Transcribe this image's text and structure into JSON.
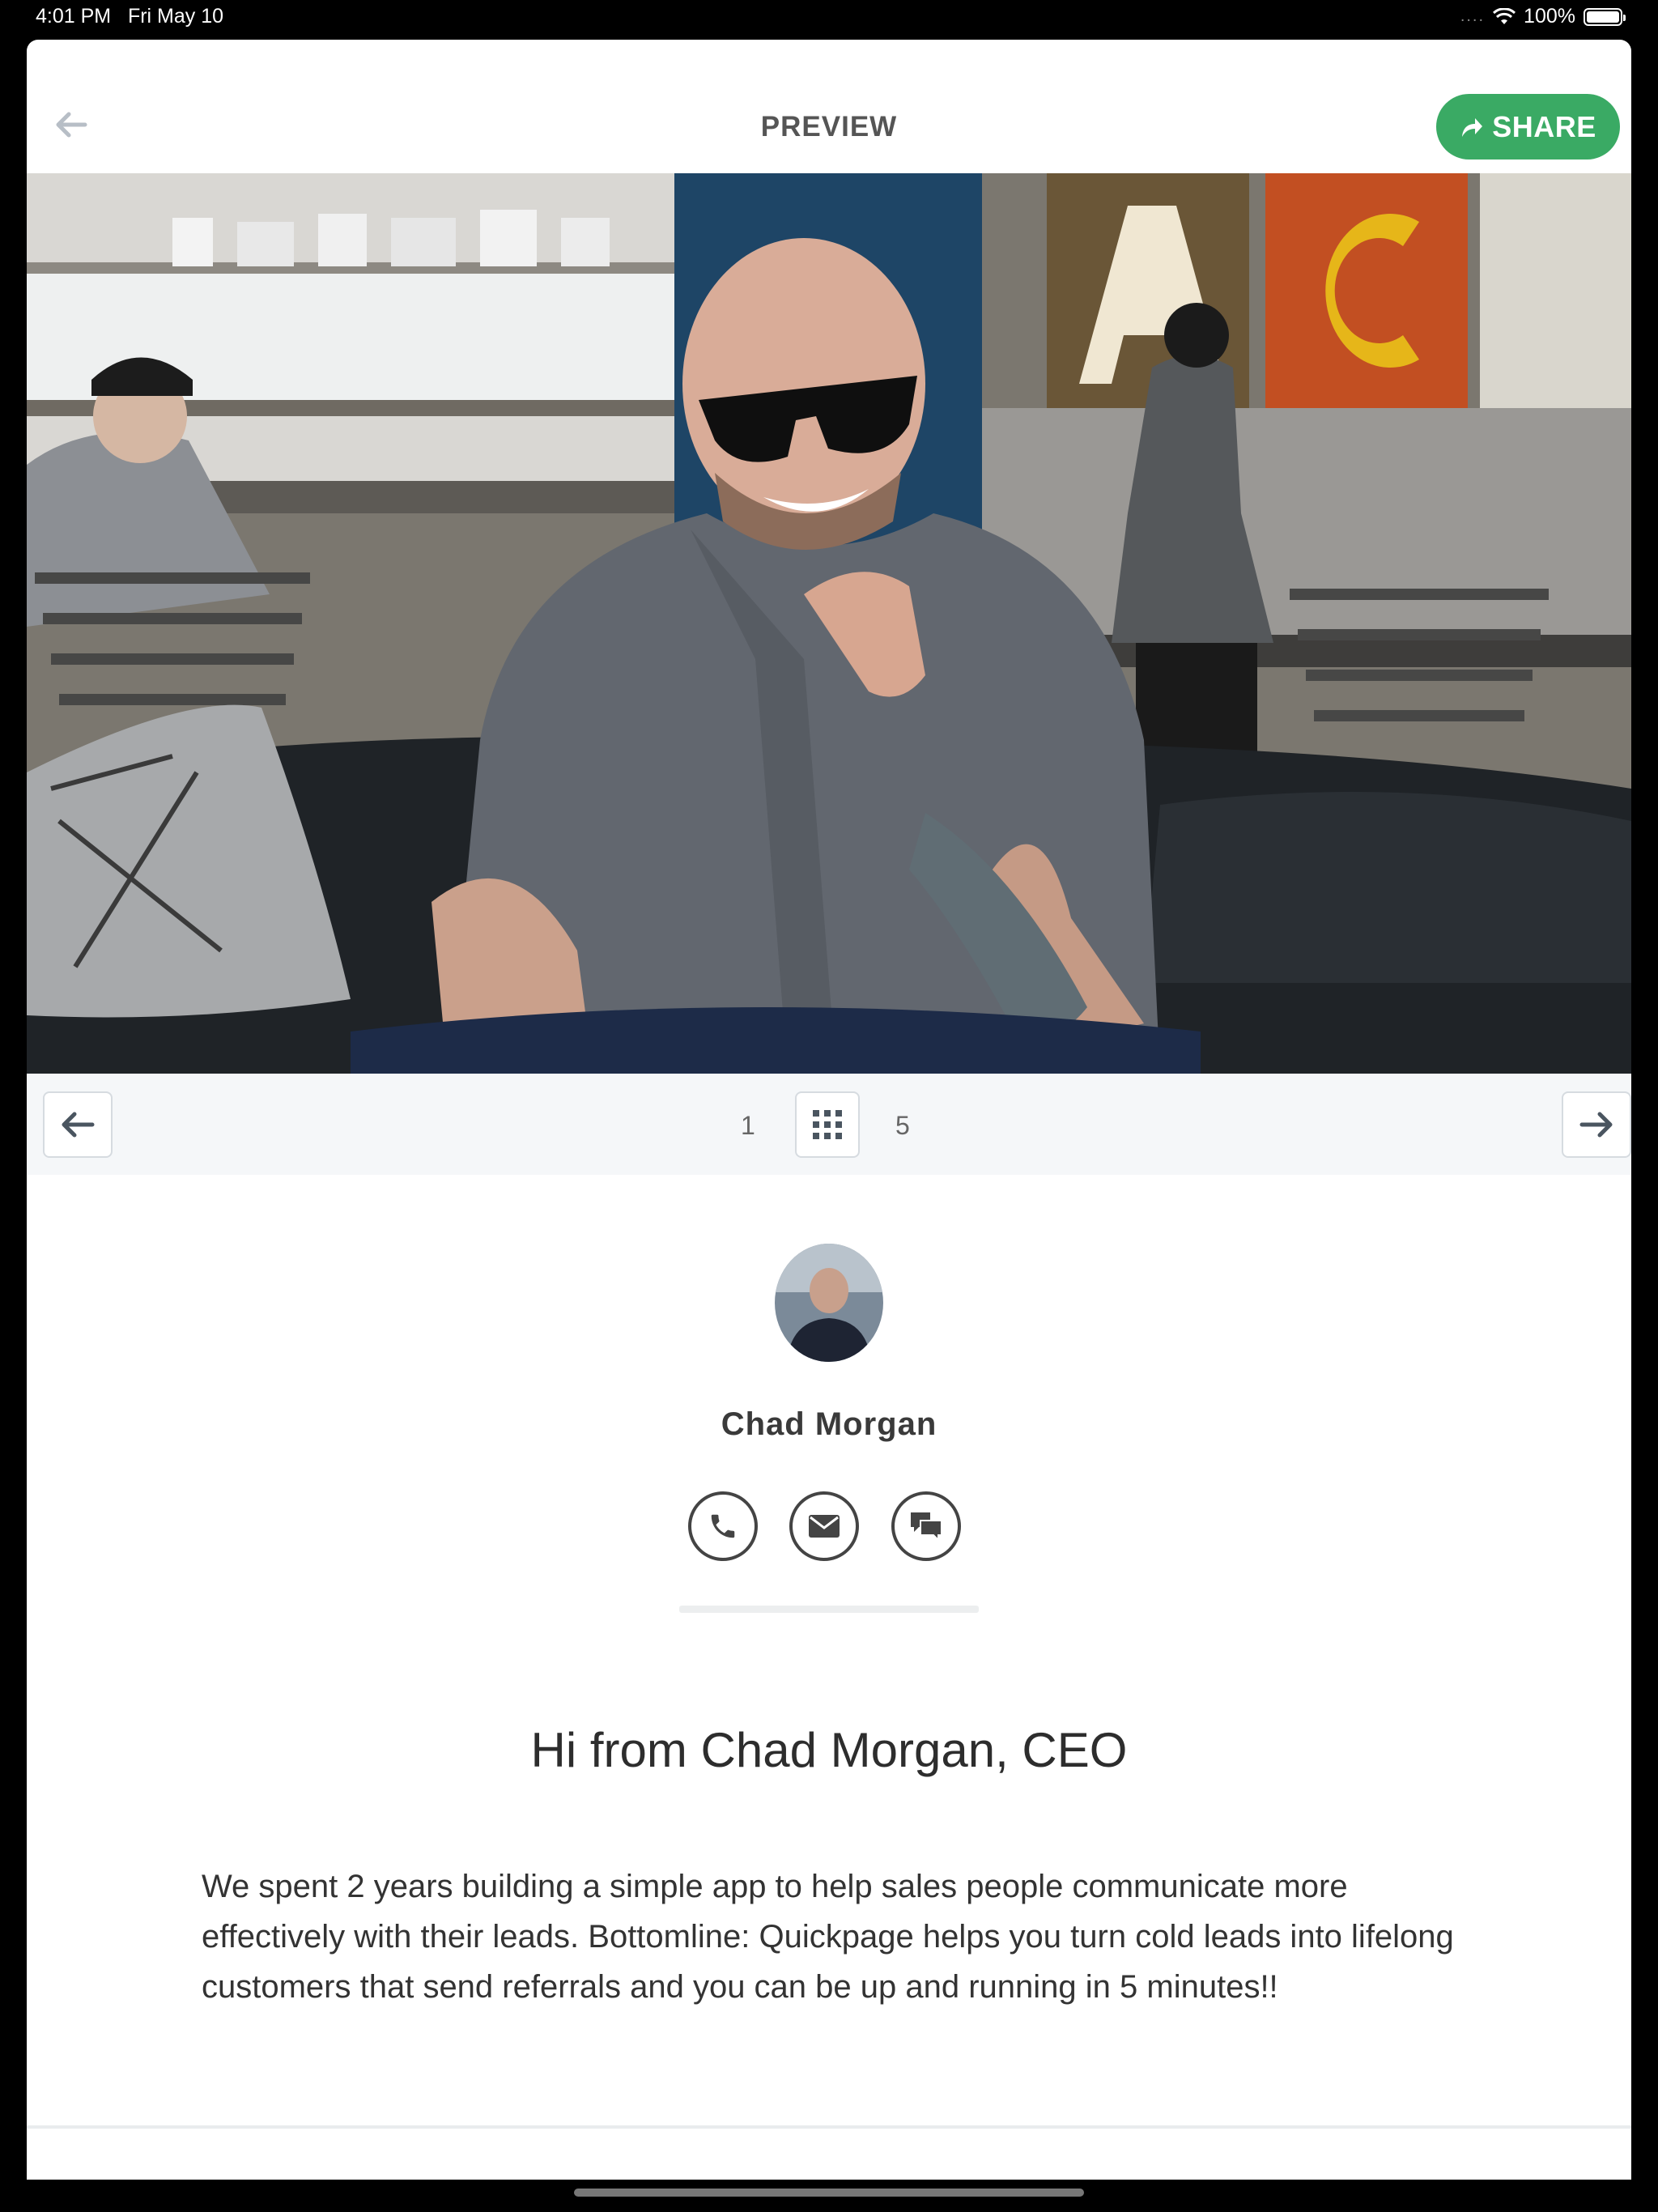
{
  "status_bar": {
    "time": "4:01 PM",
    "date": "Fri May 10",
    "battery": "100%",
    "battery_level": 1.0,
    "signal_dots": "...."
  },
  "header": {
    "title": "PREVIEW",
    "share_label": "SHARE",
    "back_icon": "back-arrow-icon",
    "share_icon": "share-arrow-icon"
  },
  "pager": {
    "current_page": "1",
    "total_pages": "5",
    "prev_icon": "arrow-left-icon",
    "next_icon": "arrow-right-icon",
    "grid_icon": "grid-icon"
  },
  "profile": {
    "name": "Chad Morgan",
    "contact_icons": [
      "phone-icon",
      "email-icon",
      "chat-icon"
    ]
  },
  "content": {
    "headline": "Hi from Chad Morgan, CEO",
    "body": "We spent 2 years building a simple app to help sales people communicate more effectively with their leads. Bottomline: Quickpage helps you turn cold leads into lifelong customers that send referrals and you can be up and running in 5 minutes!!"
  },
  "colors": {
    "share_green": "#3aaa64",
    "pager_bg": "#f5f7f9",
    "text_dark": "#2d2d2d"
  }
}
